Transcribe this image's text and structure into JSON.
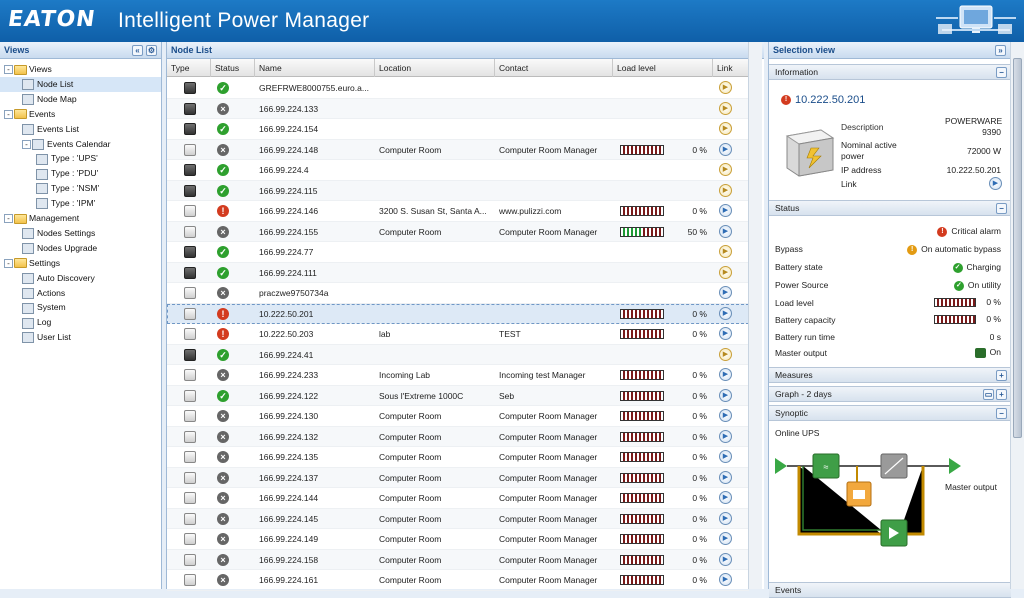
{
  "brand": {
    "logo": "EATON",
    "app_title": "Intelligent Power Manager"
  },
  "views_panel": {
    "title": "Views",
    "tree": [
      {
        "label": "Views",
        "kind": "folder",
        "level": 0,
        "expander": "-"
      },
      {
        "label": "Node List",
        "kind": "item",
        "level": 1,
        "selected": true
      },
      {
        "label": "Node Map",
        "kind": "item",
        "level": 1
      },
      {
        "label": "Events",
        "kind": "folder",
        "level": 0,
        "expander": "-"
      },
      {
        "label": "Events List",
        "kind": "item",
        "level": 1
      },
      {
        "label": "Events Calendar",
        "kind": "item",
        "level": 1,
        "expander": "-"
      },
      {
        "label": "Type : 'UPS'",
        "kind": "item",
        "level": 2
      },
      {
        "label": "Type : 'PDU'",
        "kind": "item",
        "level": 2
      },
      {
        "label": "Type : 'NSM'",
        "kind": "item",
        "level": 2
      },
      {
        "label": "Type : 'IPM'",
        "kind": "item",
        "level": 2
      },
      {
        "label": "Management",
        "kind": "folder",
        "level": 0,
        "expander": "-"
      },
      {
        "label": "Nodes Settings",
        "kind": "item",
        "level": 1
      },
      {
        "label": "Nodes Upgrade",
        "kind": "item",
        "level": 1
      },
      {
        "label": "Settings",
        "kind": "folder",
        "level": 0,
        "expander": "-"
      },
      {
        "label": "Auto Discovery",
        "kind": "item",
        "level": 1
      },
      {
        "label": "Actions",
        "kind": "item",
        "level": 1
      },
      {
        "label": "System",
        "kind": "item",
        "level": 1
      },
      {
        "label": "Log",
        "kind": "item",
        "level": 1
      },
      {
        "label": "User List",
        "kind": "item",
        "level": 1
      }
    ]
  },
  "node_list": {
    "title": "Node List",
    "columns": [
      "Type",
      "Status",
      "Name",
      "Location",
      "Contact",
      "Load level",
      "Link"
    ],
    "rows": [
      {
        "type": "pc",
        "status": "ok",
        "name": "GREFRWE8000755.euro.a...",
        "location": "",
        "contact": "",
        "load": null,
        "link": "warn"
      },
      {
        "type": "pc",
        "status": "off",
        "name": "166.99.224.133",
        "location": "",
        "contact": "",
        "load": null,
        "link": "warn"
      },
      {
        "type": "pc",
        "status": "ok",
        "name": "166.99.224.154",
        "location": "",
        "contact": "",
        "load": null,
        "link": "warn"
      },
      {
        "type": "ups",
        "status": "off",
        "name": "166.99.224.148",
        "location": "Computer Room",
        "contact": "Computer Room Manager",
        "load": 0,
        "link": "blue"
      },
      {
        "type": "pc",
        "status": "ok",
        "name": "166.99.224.4",
        "location": "",
        "contact": "",
        "load": null,
        "link": "warn"
      },
      {
        "type": "pc",
        "status": "ok",
        "name": "166.99.224.115",
        "location": "",
        "contact": "",
        "load": null,
        "link": "warn"
      },
      {
        "type": "ups",
        "status": "crit",
        "name": "166.99.224.146",
        "location": "3200 S. Susan St, Santa A...",
        "contact": "www.pulizzi.com",
        "load": 0,
        "link": "blue"
      },
      {
        "type": "ups",
        "status": "off",
        "name": "166.99.224.155",
        "location": "Computer Room",
        "contact": "Computer Room Manager",
        "load": 50,
        "link": "blue"
      },
      {
        "type": "pc",
        "status": "ok",
        "name": "166.99.224.77",
        "location": "",
        "contact": "",
        "load": null,
        "link": "warn"
      },
      {
        "type": "pc",
        "status": "ok",
        "name": "166.99.224.111",
        "location": "",
        "contact": "",
        "load": null,
        "link": "warn"
      },
      {
        "type": "ups",
        "status": "off",
        "name": "praczwe9750734a",
        "location": "",
        "contact": "",
        "load": null,
        "link": "blue"
      },
      {
        "type": "ups",
        "status": "crit",
        "name": "10.222.50.201",
        "location": "",
        "contact": "",
        "load": 0,
        "link": "blue",
        "highlight": true
      },
      {
        "type": "ups",
        "status": "crit",
        "name": "10.222.50.203",
        "location": "lab",
        "contact": "TEST",
        "load": 0,
        "link": "blue"
      },
      {
        "type": "pc",
        "status": "ok",
        "name": "166.99.224.41",
        "location": "",
        "contact": "",
        "load": null,
        "link": "warn"
      },
      {
        "type": "ups",
        "status": "off",
        "name": "166.99.224.233",
        "location": "Incoming Lab",
        "contact": "Incoming test Manager",
        "load": 0,
        "link": "blue"
      },
      {
        "type": "ups",
        "status": "ok",
        "name": "166.99.224.122",
        "location": "Sous l'Extreme 1000C",
        "contact": "Seb",
        "load": 0,
        "link": "blue"
      },
      {
        "type": "ups",
        "status": "off",
        "name": "166.99.224.130",
        "location": "Computer Room",
        "contact": "Computer Room Manager",
        "load": 0,
        "link": "blue"
      },
      {
        "type": "ups",
        "status": "off",
        "name": "166.99.224.132",
        "location": "Computer Room",
        "contact": "Computer Room Manager",
        "load": 0,
        "link": "blue"
      },
      {
        "type": "ups",
        "status": "off",
        "name": "166.99.224.135",
        "location": "Computer Room",
        "contact": "Computer Room Manager",
        "load": 0,
        "link": "blue"
      },
      {
        "type": "ups",
        "status": "off",
        "name": "166.99.224.137",
        "location": "Computer Room",
        "contact": "Computer Room Manager",
        "load": 0,
        "link": "blue"
      },
      {
        "type": "ups",
        "status": "off",
        "name": "166.99.224.144",
        "location": "Computer Room",
        "contact": "Computer Room Manager",
        "load": 0,
        "link": "blue"
      },
      {
        "type": "ups",
        "status": "off",
        "name": "166.99.224.145",
        "location": "Computer Room",
        "contact": "Computer Room Manager",
        "load": 0,
        "link": "blue"
      },
      {
        "type": "ups",
        "status": "off",
        "name": "166.99.224.149",
        "location": "Computer Room",
        "contact": "Computer Room Manager",
        "load": 0,
        "link": "blue"
      },
      {
        "type": "ups",
        "status": "off",
        "name": "166.99.224.158",
        "location": "Computer Room",
        "contact": "Computer Room Manager",
        "load": 0,
        "link": "blue"
      },
      {
        "type": "ups",
        "status": "off",
        "name": "166.99.224.161",
        "location": "Computer Room",
        "contact": "Computer Room Manager",
        "load": 0,
        "link": "blue"
      }
    ]
  },
  "selection": {
    "title": "Selection view",
    "info": {
      "header": "Information",
      "ip_title": "10.222.50.201",
      "description_label": "Description",
      "description_value": "POWERWARE 9390",
      "nominal_label": "Nominal active power",
      "nominal_value": "72000 W",
      "ip_label": "IP address",
      "ip_value": "10.222.50.201",
      "link_label": "Link"
    },
    "status": {
      "header": "Status",
      "alarm": "Critical alarm",
      "bypass_label": "Bypass",
      "bypass_value": "On automatic bypass",
      "battery_state_label": "Battery state",
      "battery_state_value": "Charging",
      "power_source_label": "Power Source",
      "power_source_value": "On utility",
      "load_level_label": "Load level",
      "load_level_value": "0 %",
      "battery_capacity_label": "Battery capacity",
      "battery_capacity_value": "0 %",
      "battery_runtime_label": "Battery run time",
      "battery_runtime_value": "0 s",
      "master_output_label": "Master output",
      "master_output_value": "On"
    },
    "measures_header": "Measures",
    "graph_header": "Graph - 2 days",
    "synoptic": {
      "header": "Synoptic",
      "mode": "Online UPS",
      "output_label": "Master output"
    },
    "collapsed_next_header": "Events"
  },
  "colors": {
    "brand_blue": "#1466b2",
    "ok": "#2ea02e",
    "critical": "#d33b1f",
    "warning": "#e39b12"
  }
}
